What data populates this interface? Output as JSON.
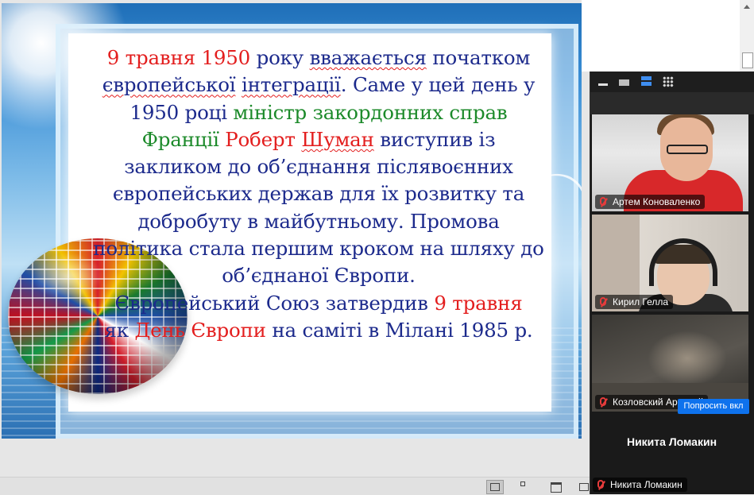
{
  "slide": {
    "lines": [
      [
        {
          "t": "9 травня 1950",
          "c": "red"
        },
        {
          "t": " року ",
          "c": "blue"
        },
        {
          "t": "вважається",
          "c": "blue",
          "sq": true
        },
        {
          "t": " початком",
          "c": "blue"
        }
      ],
      [
        {
          "t": "європейської",
          "c": "blue",
          "sq": true
        },
        {
          "t": " ",
          "c": "blue"
        },
        {
          "t": "інтеграції",
          "c": "blue",
          "sq": true
        },
        {
          "t": ". Саме у цей день у",
          "c": "blue"
        }
      ],
      [
        {
          "t": "1950 році ",
          "c": "blue"
        },
        {
          "t": "міністр закордонних справ",
          "c": "green"
        }
      ],
      [
        {
          "t": "Франції ",
          "c": "green"
        },
        {
          "t": "Роберт ",
          "c": "red"
        },
        {
          "t": "Шуман",
          "c": "red",
          "sq": true
        },
        {
          "t": " виступив із",
          "c": "blue"
        }
      ],
      [
        {
          "t": "закликом до об’єднання післявоєнних",
          "c": "blue"
        }
      ],
      [
        {
          "t": "європейських держав для їх розвитку та",
          "c": "blue"
        }
      ],
      [
        {
          "t": "добробуту в майбутньому. Промова",
          "c": "blue"
        }
      ],
      [
        {
          "t": "політика стала першим кроком на шляху до",
          "c": "blue"
        }
      ],
      [
        {
          "t": "об’єднаної Європи.",
          "c": "blue"
        }
      ],
      [
        {
          "t": "Європейський Союз затвердив ",
          "c": "blue"
        },
        {
          "t": "9 травня",
          "c": "red"
        }
      ],
      [
        {
          "t": "як ",
          "c": "blue"
        },
        {
          "t": "День Європи",
          "c": "red"
        },
        {
          "t": " на саміті в Мілані 1985 р.",
          "c": "blue"
        }
      ]
    ]
  },
  "participants": [
    {
      "name": "Артем Коноваленко"
    },
    {
      "name": "Кирил Гелла"
    },
    {
      "name": "Козловский Арсений"
    }
  ],
  "ask_button": "Попросить вкл",
  "avatar_tile_name": "Никита Ломакин",
  "bottom_tag_name": "Никита Ломакин",
  "icons": {
    "toolbar": [
      "minimize-icon",
      "window-icon",
      "speaker-view-icon",
      "gallery-view-icon"
    ],
    "statusbar": [
      "normal-view-icon",
      "slide-sorter-icon",
      "reading-view-icon",
      "slideshow-icon"
    ]
  },
  "colors": {
    "slide_blue": "#1c2a8c",
    "slide_red": "#e31e1e",
    "slide_green": "#1c8a2a",
    "zoom_blue": "#0e72ed",
    "zoom_bg": "#1a1a1a"
  }
}
